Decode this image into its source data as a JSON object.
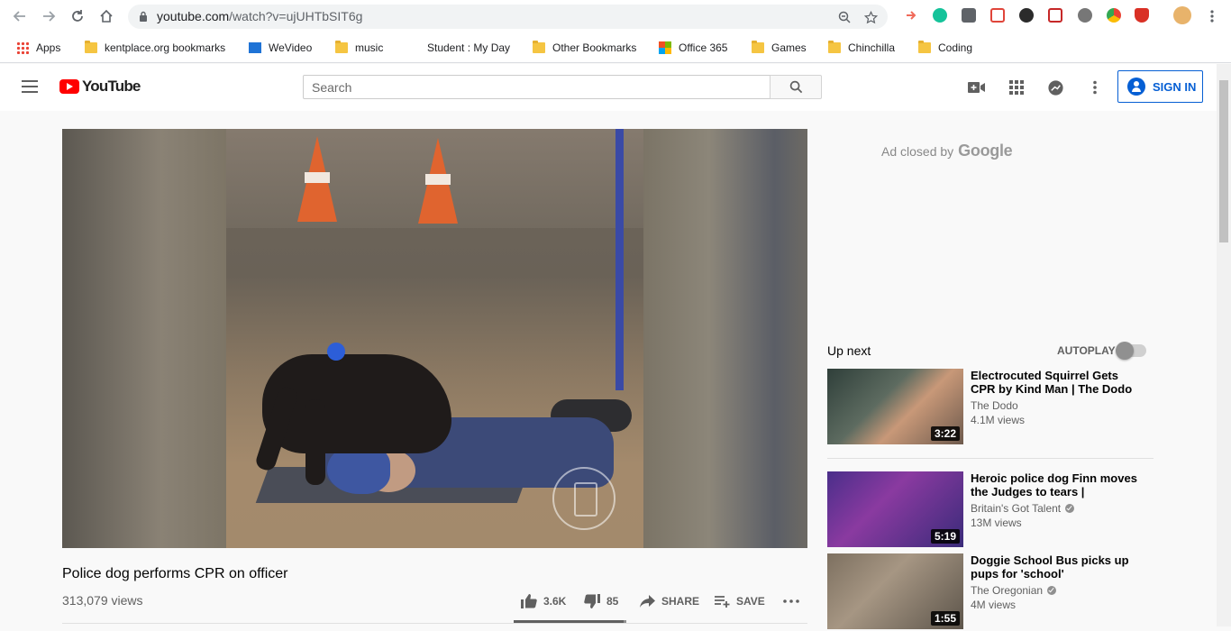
{
  "browser": {
    "url_domain": "youtube.com",
    "url_path": "/watch?v=ujUHTbSIT6g"
  },
  "bookmarks": [
    {
      "label": "Apps",
      "icon": "apps-grid-icon"
    },
    {
      "label": "kentplace.org bookmarks",
      "icon": "folder-icon"
    },
    {
      "label": "WeVideo",
      "icon": "wevideo-icon"
    },
    {
      "label": "music",
      "icon": "folder-icon"
    },
    {
      "label": "Student : My Day",
      "icon": "none"
    },
    {
      "label": "Other Bookmarks",
      "icon": "folder-icon"
    },
    {
      "label": "Office 365",
      "icon": "office-icon"
    },
    {
      "label": "Games",
      "icon": "folder-icon"
    },
    {
      "label": "Chinchilla",
      "icon": "folder-icon"
    },
    {
      "label": "Coding",
      "icon": "folder-icon"
    }
  ],
  "masthead": {
    "logo_text": "YouTube",
    "search_placeholder": "Search",
    "signin_label": "SIGN IN"
  },
  "video": {
    "title": "Police dog performs CPR on officer",
    "views": "313,079 views",
    "likes": "3.6K",
    "dislikes": "85",
    "share_label": "SHARE",
    "save_label": "SAVE",
    "like_ratio": 0.977
  },
  "sidebar": {
    "ad_text": "Ad closed by",
    "ad_brand": "Google",
    "up_next": "Up next",
    "autoplay": "AUTOPLAY",
    "autoplay_on": false,
    "recommendations": [
      {
        "title": "Electrocuted Squirrel Gets CPR by Kind Man | The Dodo",
        "channel": "The Dodo",
        "verified": false,
        "views": "4.1M views",
        "duration": "3:22"
      },
      {
        "title": "Heroic police dog Finn moves the Judges to tears | Auditions...",
        "channel": "Britain's Got Talent",
        "verified": true,
        "views": "13M views",
        "duration": "5:19"
      },
      {
        "title": "Doggie School Bus picks up pups for 'school'",
        "channel": "The Oregonian",
        "verified": true,
        "views": "4M views",
        "duration": "1:55"
      }
    ]
  },
  "colors": {
    "brand_red": "#ff0000",
    "signin_blue": "#065fd4"
  }
}
